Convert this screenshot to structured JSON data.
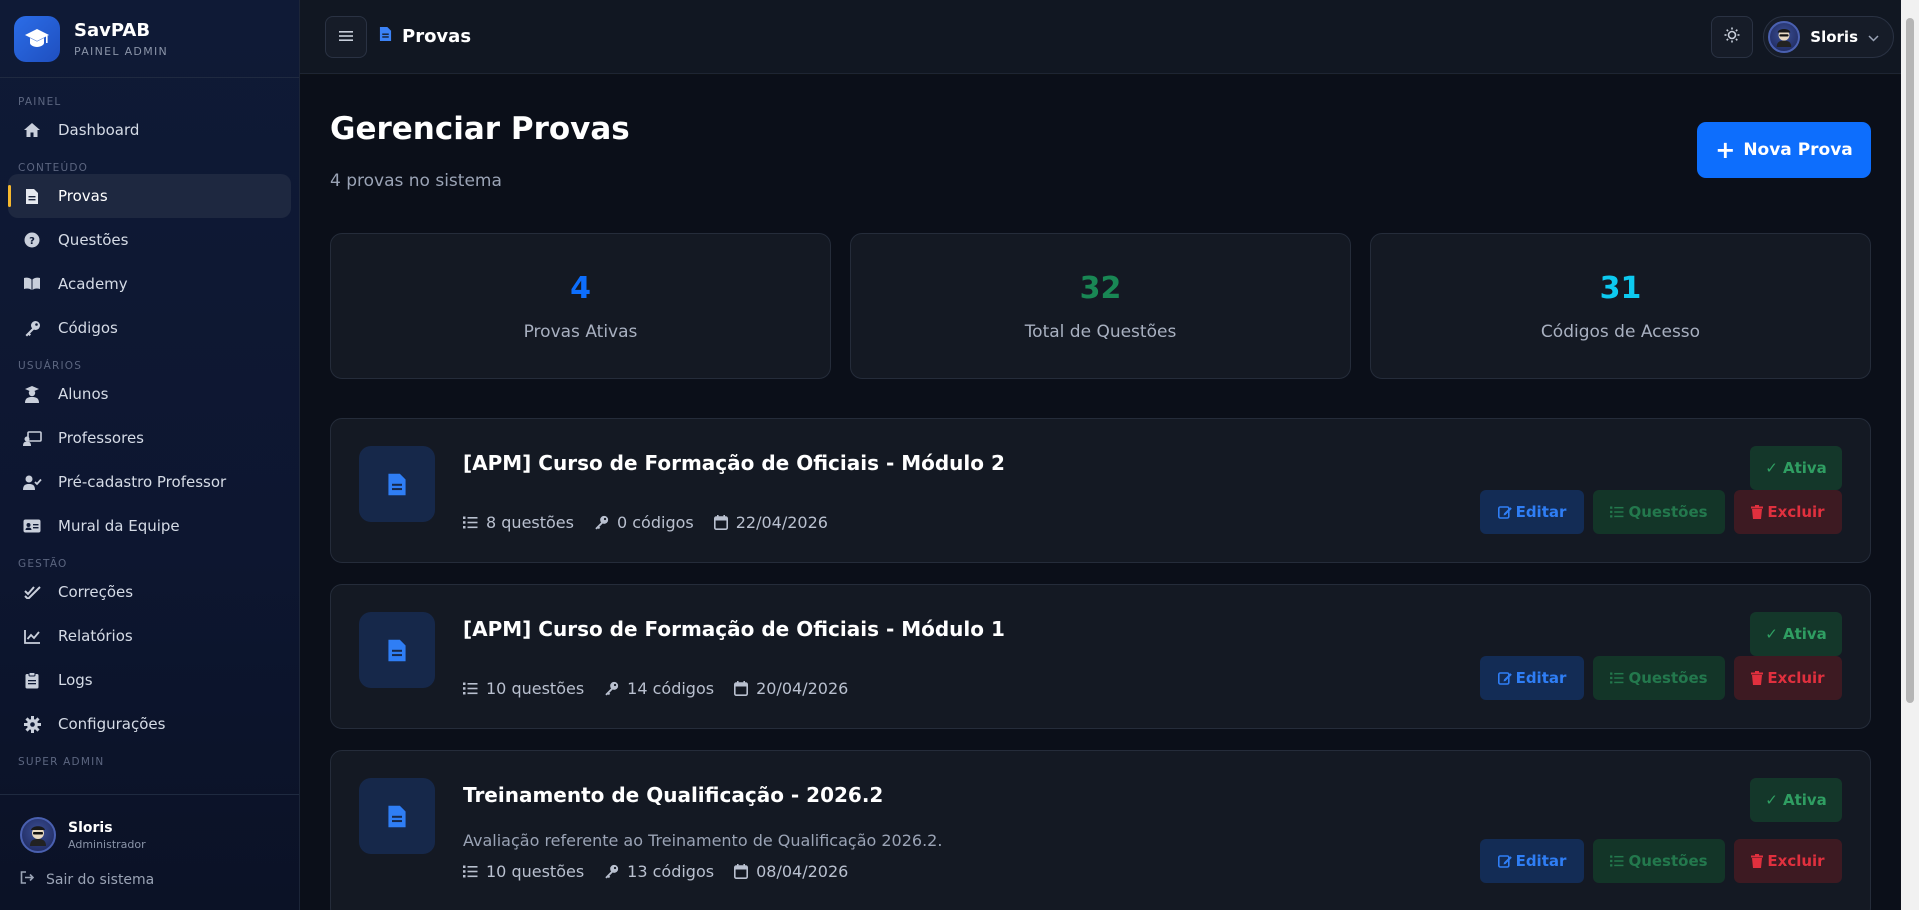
{
  "brand": {
    "name": "SavPAB",
    "subtitle": "PAINEL ADMIN"
  },
  "sidebar": {
    "sections": {
      "painel": "PAINEL",
      "conteudo": "CONTEÚDO",
      "usuarios": "USUÁRIOS",
      "gestao": "GESTÃO",
      "super_admin": "SUPER ADMIN"
    },
    "items": {
      "dashboard": "Dashboard",
      "provas": "Provas",
      "questoes": "Questões",
      "academy": "Academy",
      "codigos": "Códigos",
      "alunos": "Alunos",
      "professores": "Professores",
      "pre_cadastro": "Pré-cadastro Professor",
      "mural": "Mural da Equipe",
      "correcoes": "Correções",
      "relatorios": "Relatórios",
      "logs": "Logs",
      "configuracoes": "Configurações"
    },
    "active": "provas",
    "user": {
      "name": "Sloris",
      "role": "Administrador"
    },
    "logout": "Sair do sistema"
  },
  "topbar": {
    "breadcrumb": "Provas",
    "user_name": "Sloris"
  },
  "main": {
    "title": "Gerenciar Provas",
    "subtitle": "4 provas no sistema",
    "new_button": "Nova Prova",
    "stats": [
      {
        "value": "4",
        "label": "Provas Ativas",
        "color": "#0d6efd"
      },
      {
        "value": "32",
        "label": "Total de Questões",
        "color": "#198754"
      },
      {
        "value": "31",
        "label": "Códigos de Acesso",
        "color": "#0dcaf0"
      }
    ],
    "exams": [
      {
        "title": "[APM] Curso de Formação de Oficiais - Módulo 2",
        "description": "",
        "questions": "8 questões",
        "codes": "0 códigos",
        "date": "22/04/2026",
        "status": "✓ Ativa"
      },
      {
        "title": "[APM] Curso de Formação de Oficiais - Módulo 1",
        "description": "",
        "questions": "10 questões",
        "codes": "14 códigos",
        "date": "20/04/2026",
        "status": "✓ Ativa"
      },
      {
        "title": "Treinamento de Qualificação - 2026.2",
        "description": "Avaliação referente ao Treinamento de Qualificação 2026.2.",
        "questions": "10 questões",
        "codes": "13 códigos",
        "date": "08/04/2026",
        "status": "✓ Ativa"
      }
    ],
    "actions": {
      "edit": "Editar",
      "questions": "Questões",
      "delete": "Excluir"
    }
  }
}
